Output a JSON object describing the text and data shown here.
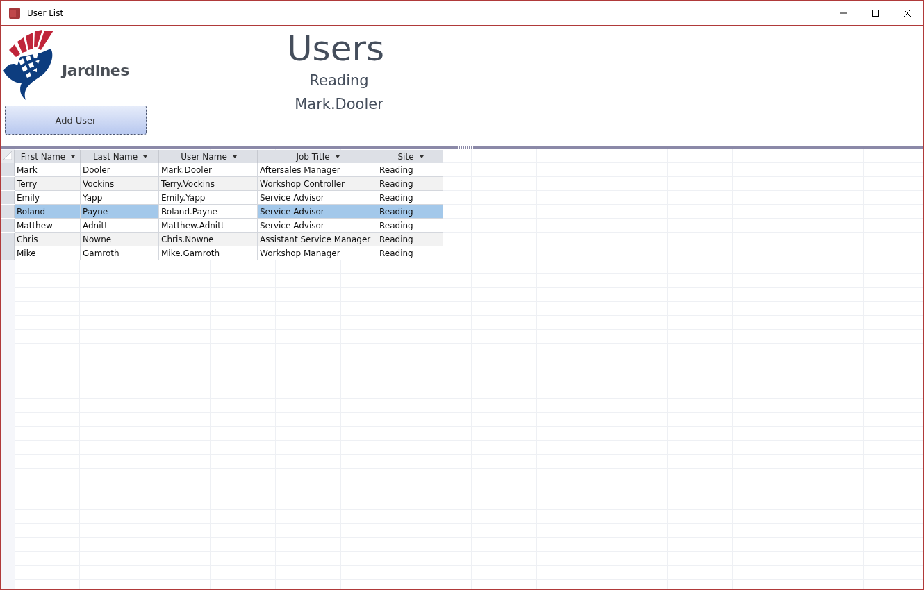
{
  "window": {
    "title": "User List"
  },
  "header": {
    "logo_text": "Jardines",
    "add_button": "Add User",
    "title": "Users",
    "site": "Reading",
    "user": "Mark.Dooler"
  },
  "table": {
    "columns": [
      {
        "label": "First Name",
        "current": false
      },
      {
        "label": "Last Name",
        "current": false
      },
      {
        "label": "User Name",
        "current": true
      },
      {
        "label": "Job Title",
        "current": false
      },
      {
        "label": "Site",
        "current": false
      }
    ],
    "rows": [
      {
        "cells": [
          "Mark",
          "Dooler",
          "Mark.Dooler",
          "Aftersales Manager",
          "Reading"
        ],
        "selected": false
      },
      {
        "cells": [
          "Terry",
          "Vockins",
          "Terry.Vockins",
          "Workshop Controller",
          "Reading"
        ],
        "selected": false
      },
      {
        "cells": [
          "Emily",
          "Yapp",
          "Emily.Yapp",
          "Service Advisor",
          "Reading"
        ],
        "selected": false
      },
      {
        "cells": [
          "Roland",
          "Payne",
          "Roland.Payne",
          "Service Advisor",
          "Reading"
        ],
        "selected": true
      },
      {
        "cells": [
          "Matthew",
          "Adnitt",
          "Matthew.Adnitt",
          "Service Advisor",
          "Reading"
        ],
        "selected": false
      },
      {
        "cells": [
          "Chris",
          "Nowne",
          "Chris.Nowne",
          "Assistant Service Manager",
          "Reading"
        ],
        "selected": false
      },
      {
        "cells": [
          "Mike",
          "Gamroth",
          "Mike.Gamroth",
          "Workshop Manager",
          "Reading"
        ],
        "selected": false
      }
    ]
  }
}
